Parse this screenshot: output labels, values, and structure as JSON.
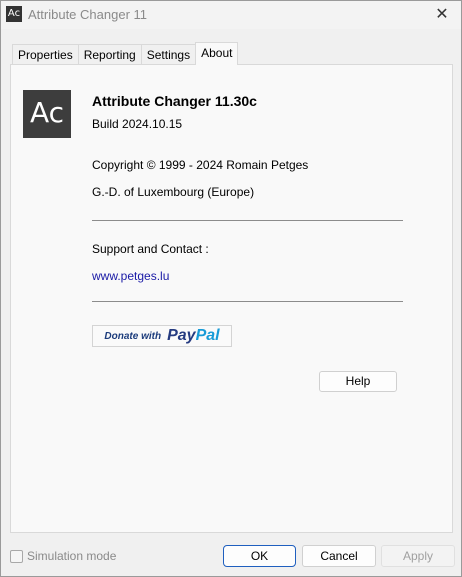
{
  "window": {
    "title": "Attribute Changer 11",
    "app_icon_text": "Ac",
    "close_glyph": "✕"
  },
  "tabs": [
    {
      "label": "Properties",
      "active": false
    },
    {
      "label": "Reporting",
      "active": false
    },
    {
      "label": "Settings",
      "active": false
    },
    {
      "label": "About",
      "active": true
    }
  ],
  "about": {
    "logo_text": "Ac",
    "app_name": "Attribute Changer 11.30c",
    "build": "Build 2024.10.15",
    "copyright": "Copyright © 1999 - 2024 Romain Petges",
    "country": "G.-D. of Luxembourg (Europe)",
    "support_label": "Support and Contact :",
    "website": "www.petges.lu",
    "donate_text": "Donate with",
    "paypal_part1": "Pay",
    "paypal_part2": "Pal",
    "help_label": "Help"
  },
  "footer": {
    "simulation_label": "Simulation mode",
    "simulation_checked": false,
    "ok_label": "OK",
    "cancel_label": "Cancel",
    "apply_label": "Apply"
  },
  "colors": {
    "link": "#1a1aa6",
    "paypal_dark": "#253b80",
    "paypal_light": "#179bd7",
    "ok_border": "#1f5fbf"
  }
}
